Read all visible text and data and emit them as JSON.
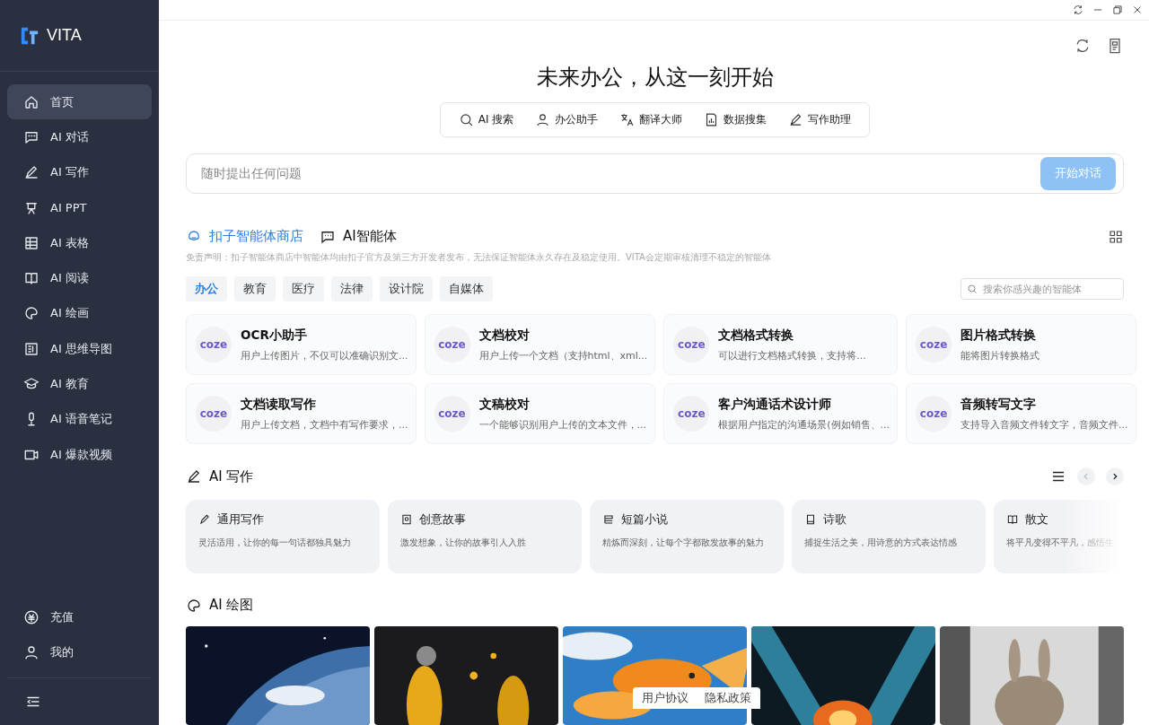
{
  "app": {
    "name": "VITA"
  },
  "sidebar": {
    "items": [
      {
        "label": "首页",
        "selected": true
      },
      {
        "label": "AI 对话",
        "selected": false
      },
      {
        "label": "AI 写作",
        "selected": false
      },
      {
        "label": "AI PPT",
        "selected": false
      },
      {
        "label": "AI 表格",
        "selected": false
      },
      {
        "label": "AI 阅读",
        "selected": false
      },
      {
        "label": "AI 绘画",
        "selected": false
      },
      {
        "label": "AI 思维导图",
        "selected": false
      },
      {
        "label": "AI 教育",
        "selected": false
      },
      {
        "label": "AI 语音笔记",
        "selected": false
      },
      {
        "label": "AI 爆款视频",
        "selected": false
      }
    ],
    "bottom_items": [
      {
        "label": "充值"
      },
      {
        "label": "我的"
      }
    ]
  },
  "hero": {
    "title": "未来办公，从这一刻开始",
    "tools": [
      "AI 搜索",
      "办公助手",
      "翻译大师",
      "数据搜集",
      "写作助理"
    ],
    "input": {
      "placeholder": "随时提出任何问题"
    },
    "send_button": "开始对话"
  },
  "agents": {
    "tabs": [
      {
        "label": "扣子智能体商店",
        "selected": true
      },
      {
        "label": "AI智能体",
        "selected": false
      }
    ],
    "disclaimer": "免责声明：扣子智能体商店中智能体均由扣子官方及第三方开发者发布，无法保证智能体永久存在及稳定使用。VITA会定期审核清理不稳定的智能体",
    "categories": [
      {
        "label": "办公",
        "selected": true
      },
      {
        "label": "教育",
        "selected": false
      },
      {
        "label": "医疗",
        "selected": false
      },
      {
        "label": "法律",
        "selected": false
      },
      {
        "label": "设计院",
        "selected": false
      },
      {
        "label": "自媒体",
        "selected": false
      }
    ],
    "search": {
      "placeholder": "搜索你感兴趣的智能体"
    },
    "cards": [
      {
        "logo": "coze",
        "title": "OCR小助手",
        "desc": "用户上传图片，不仅可以准确识别文..."
      },
      {
        "logo": "coze",
        "title": "文档校对",
        "desc": "用户上传一个文档（支持html、xml..."
      },
      {
        "logo": "coze",
        "title": "文档格式转换",
        "desc": "可以进行文档格式转换，支持将..."
      },
      {
        "logo": "coze",
        "title": "图片格式转换",
        "desc": "能将图片转换格式"
      },
      {
        "logo": "coze",
        "title": "文档读取写作",
        "desc": "用户上传文档，文档中有写作要求，..."
      },
      {
        "logo": "coze",
        "title": "文稿校对",
        "desc": "一个能够识别用户上传的文本文件，..."
      },
      {
        "logo": "coze",
        "title": "客户沟通话术设计师",
        "desc": "根据用户指定的沟通场景(例如销售、..."
      },
      {
        "logo": "coze",
        "title": "音频转写文字",
        "desc": "支持导入音频文件转文字，音频文件..."
      }
    ]
  },
  "writing": {
    "title": "AI 写作",
    "cards": [
      {
        "title": "通用写作",
        "desc": "灵活适用，让你的每一句话都独具魅力"
      },
      {
        "title": "创意故事",
        "desc": "激发想象，让你的故事引人入胜"
      },
      {
        "title": "短篇小说",
        "desc": "精炼而深刻，让每个字都散发故事的魅力"
      },
      {
        "title": "诗歌",
        "desc": "捕捉生活之美，用诗意的方式表达情感"
      },
      {
        "title": "散文",
        "desc": "将平凡变得不平凡，感悟生"
      }
    ]
  },
  "drawing": {
    "title": "AI 绘图"
  },
  "footer_links": [
    "用户协议",
    "隐私政策"
  ]
}
